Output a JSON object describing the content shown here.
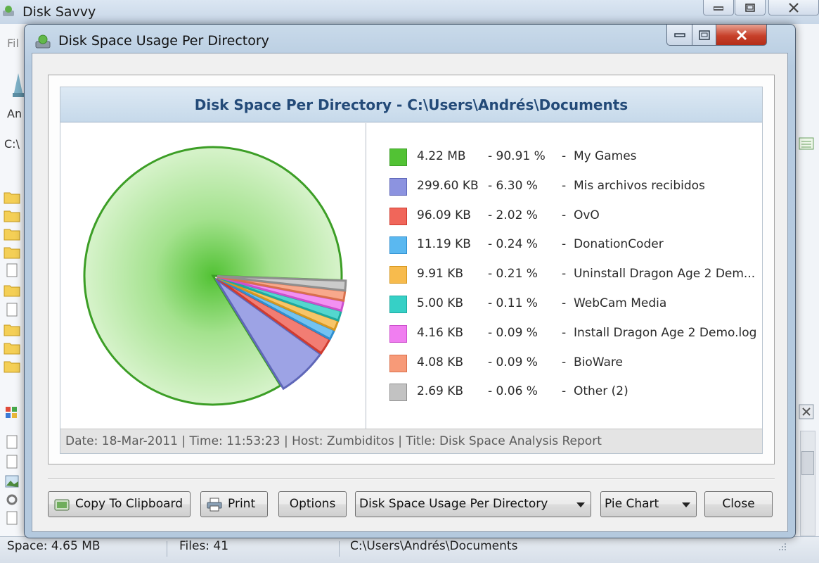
{
  "main_window": {
    "title": "Disk Savvy",
    "menu_fragment": "Fil",
    "toolbar_fragment": "An",
    "path_fragment": "C:\\",
    "status": {
      "space": "Space: 4.65 MB",
      "files": "Files: 41",
      "path": "C:\\Users\\Andrés\\Documents"
    }
  },
  "dialog": {
    "title": "Disk Space Usage Per Directory",
    "report_title": "Disk Space Per Directory - C:\\Users\\Andrés\\Documents",
    "footer": "Date: 18-Mar-2011 | Time: 11:53:23 | Host: Zumbiditos | Title: Disk Space Analysis Report",
    "buttons": {
      "copy": "Copy To Clipboard",
      "print": "Print",
      "options": "Options",
      "report_select": "Disk Space Usage Per Directory",
      "chart_select": "Pie Chart",
      "close": "Close"
    }
  },
  "chart_data": {
    "type": "pie",
    "title": "Disk Space Per Directory - C:\\Users\\Andrés\\Documents",
    "slices": [
      {
        "label": "My Games",
        "size": "4.22 MB",
        "percent": 90.91,
        "percent_text": "- 90.91 %",
        "color": "#52c234",
        "edge": "#3c9e26"
      },
      {
        "label": "Mis archivos recibidos",
        "size": "299.60 KB",
        "percent": 6.3,
        "percent_text": "- 6.30 %",
        "color": "#8c93e0",
        "edge": "#5f67b8"
      },
      {
        "label": "OvO",
        "size": "96.09 KB",
        "percent": 2.02,
        "percent_text": "- 2.02 %",
        "color": "#f0665a",
        "edge": "#cf3b2f"
      },
      {
        "label": "DonationCoder",
        "size": "11.19 KB",
        "percent": 0.24,
        "percent_text": "- 0.24 %",
        "color": "#5ab8f0",
        "edge": "#2f8ecf"
      },
      {
        "label": "Uninstall Dragon Age 2 Dem...",
        "size": "9.91 KB",
        "percent": 0.21,
        "percent_text": "- 0.21 %",
        "color": "#f7bb4d",
        "edge": "#d69720"
      },
      {
        "label": "WebCam Media",
        "size": "5.00 KB",
        "percent": 0.11,
        "percent_text": "- 0.11 %",
        "color": "#36d0c6",
        "edge": "#1ea89f"
      },
      {
        "label": "Install Dragon Age 2 Demo.log",
        "size": "4.16 KB",
        "percent": 0.09,
        "percent_text": "- 0.09 %",
        "color": "#f07ef0",
        "edge": "#cc50cc"
      },
      {
        "label": "BioWare",
        "size": "4.08 KB",
        "percent": 0.09,
        "percent_text": "- 0.09 %",
        "color": "#f79a78",
        "edge": "#d9704c"
      },
      {
        "label": "Other (2)",
        "size": "2.69 KB",
        "percent": 0.06,
        "percent_text": "- 0.06 %",
        "color": "#c2c2c2",
        "edge": "#8f8f8f"
      }
    ]
  }
}
